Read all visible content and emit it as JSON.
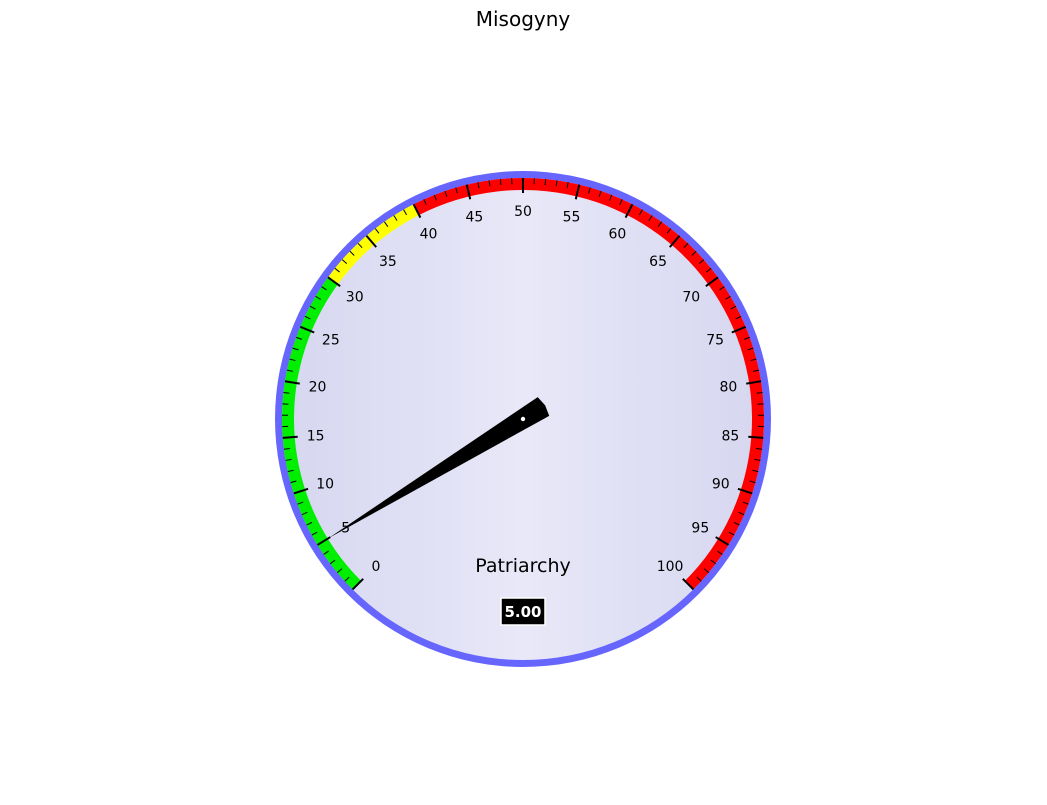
{
  "chart_data": {
    "type": "gauge",
    "title": "Misogyny",
    "label": "Patriarchy",
    "value": 5,
    "value_display": "5.00",
    "min": 0,
    "max": 100,
    "major_tick_labels": [
      "0",
      "5",
      "10",
      "15",
      "20",
      "25",
      "30",
      "35",
      "40",
      "45",
      "50",
      "55",
      "60",
      "65",
      "70",
      "75",
      "80",
      "85",
      "90",
      "95",
      "100"
    ],
    "bands": [
      {
        "from": 0,
        "to": 30,
        "color": "#00ee00"
      },
      {
        "from": 30,
        "to": 40,
        "color": "#ffff00"
      },
      {
        "from": 40,
        "to": 100,
        "color": "#ff0000"
      }
    ]
  },
  "colors": {
    "rim": "#6666ff",
    "face_edge": "#d8d8f2",
    "face_center": "#e8e8f8",
    "needle": "#000000",
    "value_box": "#000000"
  }
}
